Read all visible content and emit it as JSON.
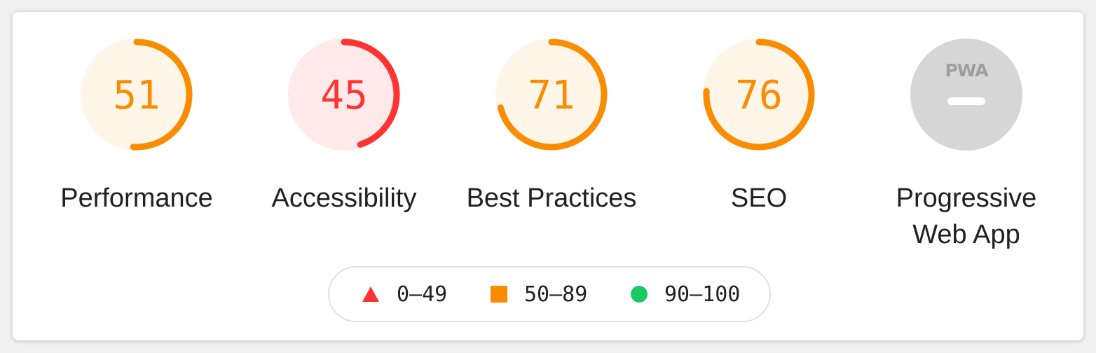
{
  "categories": [
    {
      "id": "performance",
      "score": "51",
      "label": "Performance",
      "value": 0.51,
      "color": "#fa8c00",
      "bg": "#fff5e8"
    },
    {
      "id": "accessibility",
      "score": "45",
      "label": "Accessibility",
      "value": 0.45,
      "color": "#ff3333",
      "bg": "#ffe9e9"
    },
    {
      "id": "best-practices",
      "score": "71",
      "label": "Best Practices",
      "value": 0.71,
      "color": "#fa8c00",
      "bg": "#fff5e8"
    },
    {
      "id": "seo",
      "score": "76",
      "label": "SEO",
      "value": 0.76,
      "color": "#fa8c00",
      "bg": "#fff5e8"
    }
  ],
  "pwa": {
    "badge_text": "PWA",
    "label": "Progressive\nWeb App",
    "color": "#d6d6d6"
  },
  "legend": {
    "fail": {
      "range": "0–49",
      "color": "#ff3333"
    },
    "average": {
      "range": "50–89",
      "color": "#fa8c00"
    },
    "pass": {
      "range": "90–100",
      "color": "#18c964"
    }
  }
}
